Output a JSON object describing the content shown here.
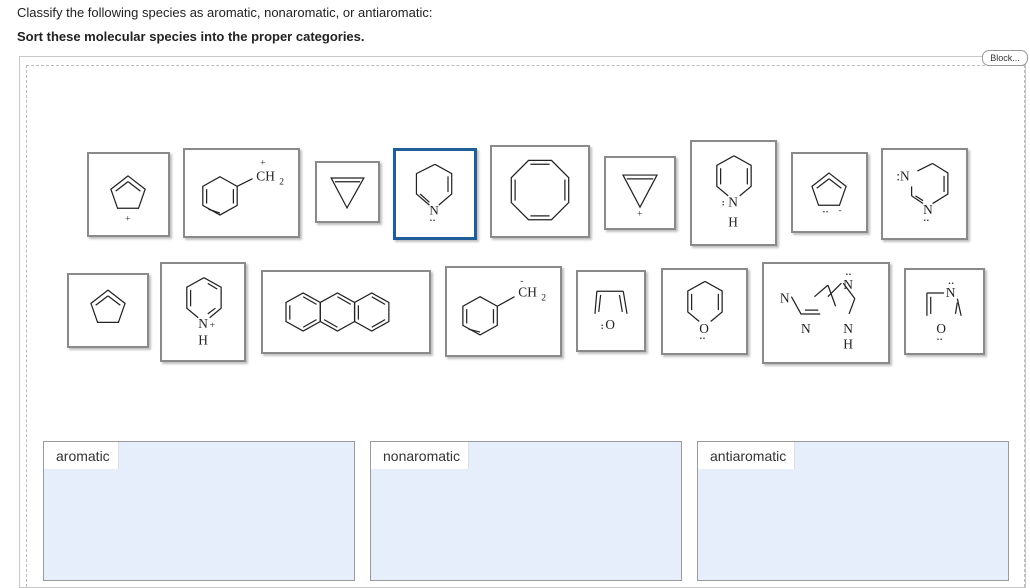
{
  "question": {
    "prompt": "Classify the following species as aromatic, nonaromatic, or antiaromatic:",
    "instruction": "Sort these molecular species into the proper categories."
  },
  "toolbar": {
    "blocks_label": "Block..."
  },
  "tiles": {
    "cyclopentadienyl_cation": {
      "charge": "+"
    },
    "benzyl_cation": {
      "group": "CH",
      "sub": "2",
      "charge": "+"
    },
    "cyclopropene": {},
    "dihydropyridine": {
      "atom": "N",
      "lone_pair": "··"
    },
    "cyclooctatetraene": {},
    "cyclopropenyl_cation": {
      "charge": "+"
    },
    "dihydropyridine_nh": {
      "atom": "N",
      "h": "H",
      "lone_pair": ":"
    },
    "cyclopentadienyl_anion": {
      "charge": "-",
      "lone_pair": "··"
    },
    "pyrimidine": {
      "atom1": ":N",
      "atom2": "N",
      "lone_pair": "··"
    },
    "cyclopentadiene": {},
    "pyridinium": {
      "atom": "N",
      "charge": "+",
      "h": "H"
    },
    "anthracene": {},
    "benzyl_anion": {
      "group": "CH",
      "sub": "2",
      "charge": "-"
    },
    "furan": {
      "atom": "O",
      "lone_pair": ":"
    },
    "pyran": {
      "atom": "O",
      "lone_pair": "··"
    },
    "purine": {
      "atom1": "N",
      "atom2": "N",
      "atom3": "N",
      "atom4": "N",
      "h": "H",
      "lone_pair": "··"
    },
    "oxazole": {
      "atom_n": "N",
      "atom_o": "O",
      "lone_pair": "··"
    }
  },
  "categories": [
    {
      "label": "aromatic"
    },
    {
      "label": "nonaromatic"
    },
    {
      "label": "antiaromatic"
    }
  ]
}
